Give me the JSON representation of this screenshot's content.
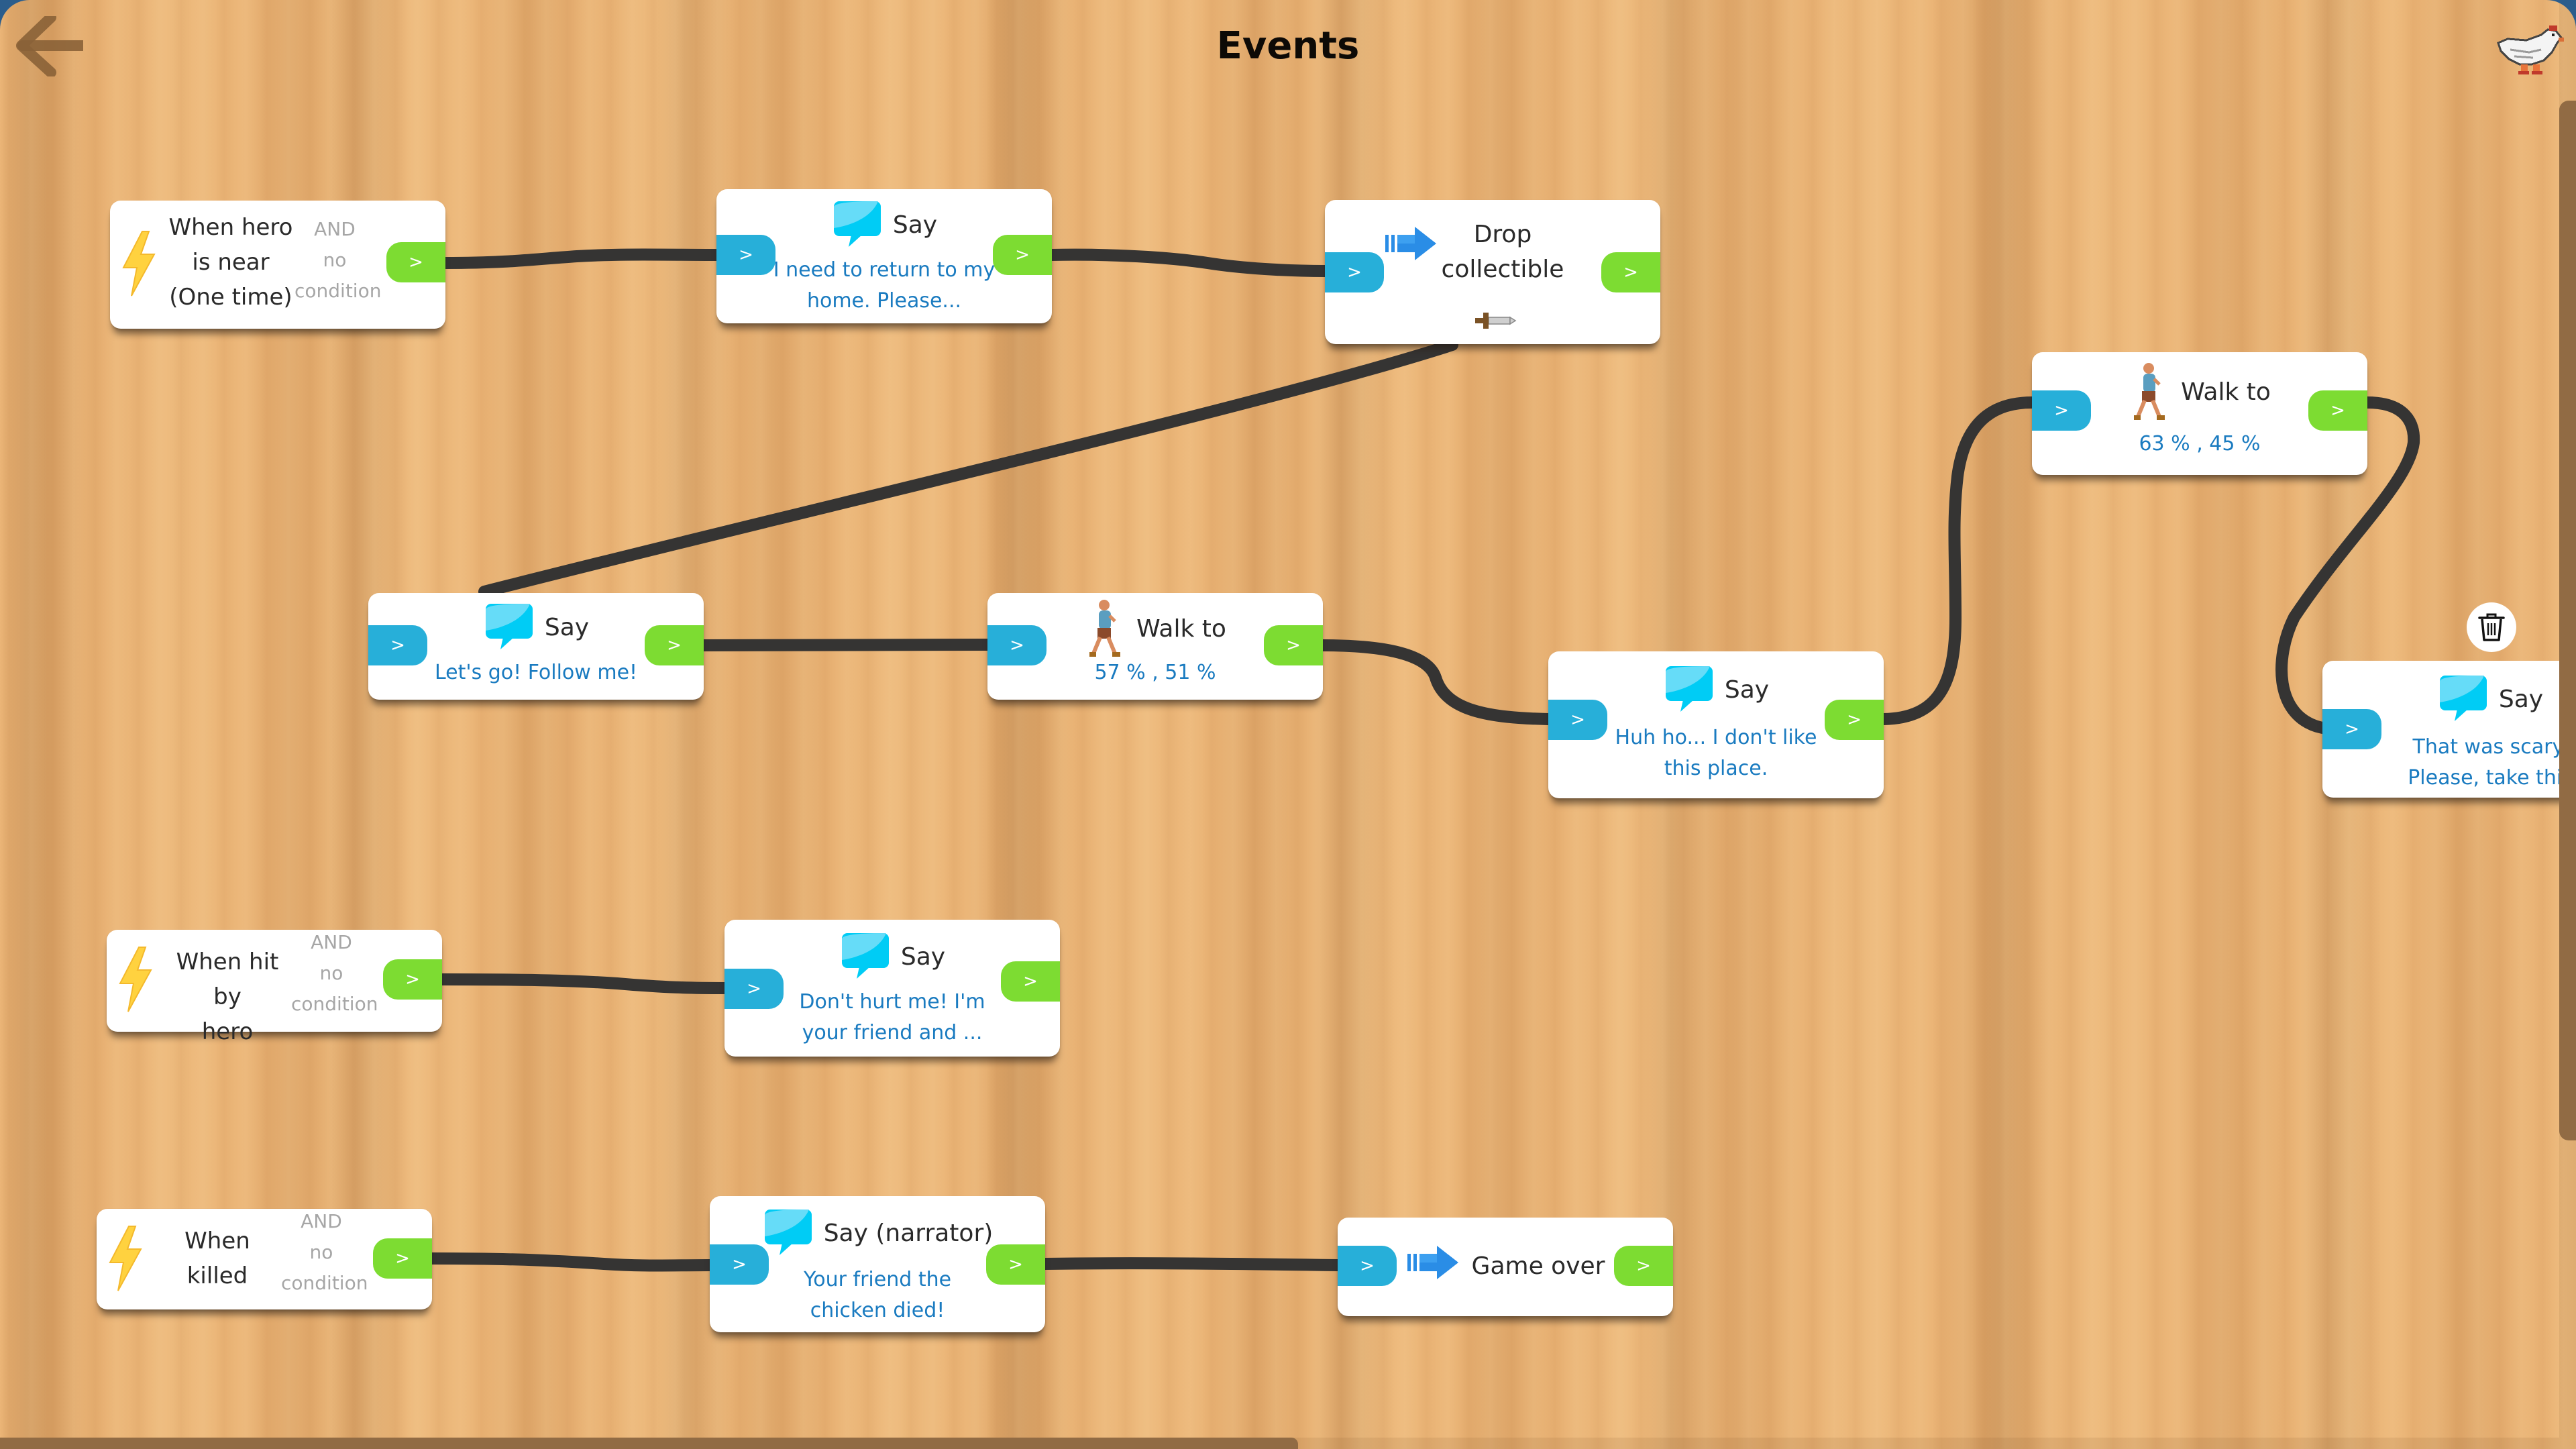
{
  "header": {
    "title": "Events",
    "back_icon": "back-arrow-icon",
    "character_icon": "chicken-icon"
  },
  "colors": {
    "in_port": "#27afd9",
    "out_port": "#7ddc32",
    "detail_text": "#1a7bc0",
    "wire": "#353433",
    "condition_text": "#a6a6a6"
  },
  "port_glyph": ">",
  "nodes": {
    "trigger_near": {
      "type": "trigger",
      "icon": "lightning-icon",
      "label": [
        "When hero",
        "is near",
        "(One time)"
      ],
      "condition": [
        "AND",
        "no",
        "condition"
      ]
    },
    "say_return": {
      "type": "action",
      "icon": "speech-bubble-icon",
      "title": "Say",
      "detail": [
        "I need to return to my",
        "home. Please..."
      ]
    },
    "drop_collectible": {
      "type": "action",
      "icon": "arrow-right-icon",
      "title": [
        "Drop",
        "collectible"
      ],
      "item_icon": "dagger-icon"
    },
    "walk_to_1": {
      "type": "action",
      "icon": "walking-person-icon",
      "title": "Walk to",
      "detail": "63 % , 45 %"
    },
    "say_scary": {
      "type": "action",
      "icon": "speech-bubble-icon",
      "title": "Say",
      "detail": [
        "That was scary.",
        "Please, take this"
      ]
    },
    "say_lets_go": {
      "type": "action",
      "icon": "speech-bubble-icon",
      "title": "Say",
      "detail": "Let's go! Follow me!"
    },
    "walk_to_2": {
      "type": "action",
      "icon": "walking-person-icon",
      "title": "Walk to",
      "detail": "57 % , 51 %"
    },
    "say_huh_ho": {
      "type": "action",
      "icon": "speech-bubble-icon",
      "title": "Say",
      "detail": [
        "Huh ho... I don't like",
        "this place."
      ]
    },
    "trigger_hit": {
      "type": "trigger",
      "icon": "lightning-icon",
      "label": [
        "When hit by",
        "hero"
      ],
      "condition": [
        "AND",
        "no",
        "condition"
      ]
    },
    "say_dont_hurt": {
      "type": "action",
      "icon": "speech-bubble-icon",
      "title": "Say",
      "detail": [
        "Don't hurt me! I'm",
        "your friend and ..."
      ]
    },
    "trigger_killed": {
      "type": "trigger",
      "icon": "lightning-icon",
      "label": [
        "When",
        "killed"
      ],
      "condition": [
        "AND",
        "no",
        "condition"
      ]
    },
    "say_narrator": {
      "type": "action",
      "icon": "speech-bubble-icon",
      "title": "Say (narrator)",
      "detail": [
        "Your friend the",
        "chicken died!"
      ]
    },
    "game_over": {
      "type": "action",
      "icon": "arrow-right-icon",
      "title": "Game over"
    }
  },
  "delete_icon": "trash-icon"
}
